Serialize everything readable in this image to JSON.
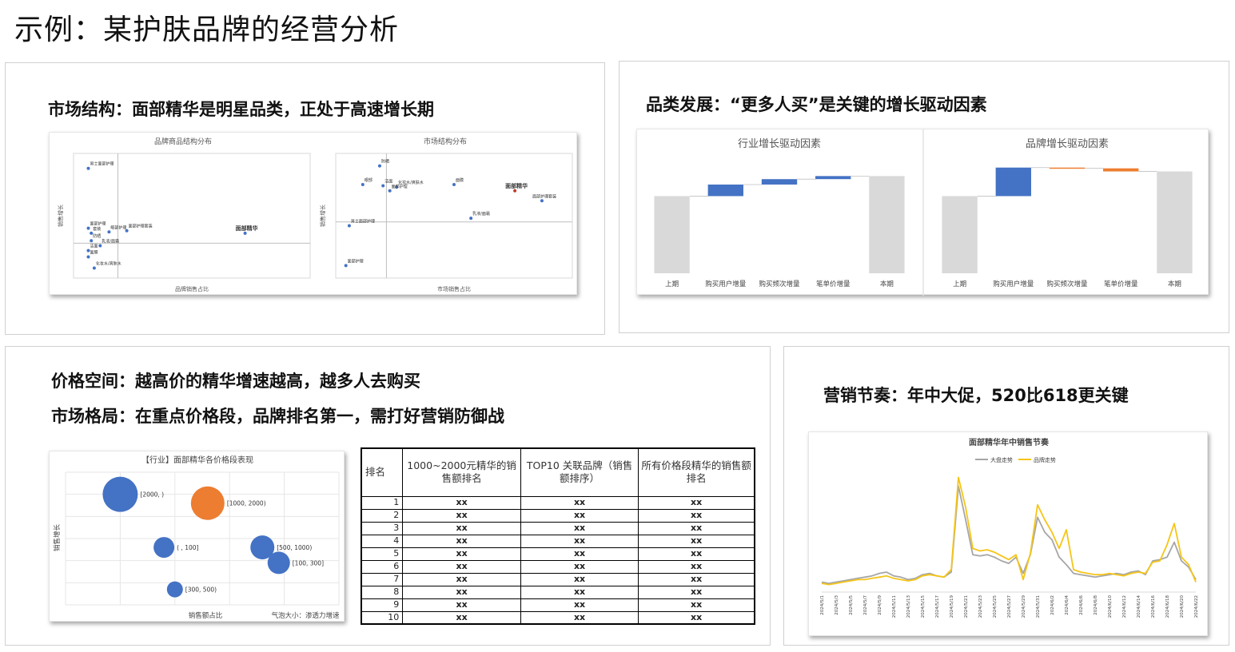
{
  "page": {
    "title": "示例：某护肤品牌的经营分析"
  },
  "panels": {
    "structure": {
      "heading": "市场结构：面部精华是明星品类，正处于高速增长期"
    },
    "category": {
      "heading": "品类发展：“更多人买”是关键的增长驱动因素"
    },
    "price": {
      "heading1": "价格空间：越高价的精华增速越高，越多人去购买",
      "heading2": "市场格局：在重点价格段，品牌排名第一，需打好营销防御战"
    },
    "marketing": {
      "heading": "营销节奏：年中大促，520比618更关键"
    }
  },
  "chart_data": [
    {
      "id": "brand-structure",
      "type": "scatter",
      "title": "品牌商品结构分布",
      "xlabel": "品牌销售占比",
      "ylabel": "销售增长",
      "points": [
        {
          "label": "男士面部护理",
          "x": 0.5,
          "y": 0.88
        },
        {
          "label": "面部护理",
          "x": 0.5,
          "y": 0.4
        },
        {
          "label": "套装",
          "x": 0.6,
          "y": 0.36
        },
        {
          "label": "眼部护理",
          "x": 1.2,
          "y": 0.37
        },
        {
          "label": "面部护理套装",
          "x": 1.8,
          "y": 0.38
        },
        {
          "label": "防晒",
          "x": 0.6,
          "y": 0.3
        },
        {
          "label": "乳液/面霜",
          "x": 0.9,
          "y": 0.26
        },
        {
          "label": "洁面",
          "x": 0.5,
          "y": 0.22
        },
        {
          "label": "面膜",
          "x": 0.5,
          "y": 0.17
        },
        {
          "label": "化妆水/爽肤水",
          "x": 0.7,
          "y": 0.08
        },
        {
          "label": "面部精华",
          "x": 5.8,
          "y": 0.36
        }
      ],
      "xlim": [
        0,
        8
      ],
      "ylim": [
        0,
        1
      ]
    },
    {
      "id": "market-structure",
      "type": "scatter",
      "title": "市场结构分布",
      "xlabel": "市场销售占比",
      "ylabel": "销售增长",
      "points": [
        {
          "label": "防晒",
          "x": 1.3,
          "y": 0.9
        },
        {
          "label": "眼部",
          "x": 0.8,
          "y": 0.75
        },
        {
          "label": "洁面",
          "x": 1.4,
          "y": 0.74
        },
        {
          "label": "化妆水/爽肤水",
          "x": 1.8,
          "y": 0.73
        },
        {
          "label": "面部护理",
          "x": 1.6,
          "y": 0.7
        },
        {
          "label": "面膜",
          "x": 3.5,
          "y": 0.75
        },
        {
          "label": "面部精华",
          "x": 5.3,
          "y": 0.7
        },
        {
          "label": "面部护理套装",
          "x": 6.1,
          "y": 0.62
        },
        {
          "label": "乳液/面霜",
          "x": 4.0,
          "y": 0.48
        },
        {
          "label": "男士面部护理",
          "x": 0.4,
          "y": 0.42
        },
        {
          "label": "面部护理",
          "x": 0.3,
          "y": 0.1
        }
      ],
      "xlim": [
        0,
        7
      ],
      "ylim": [
        0,
        1
      ]
    },
    {
      "id": "industry-drivers",
      "type": "bar",
      "title": "行业增长驱动因素",
      "categories": [
        "上期",
        "购买用户增量",
        "购买频次增量",
        "笔单价增量",
        "本期"
      ],
      "values": [
        100,
        15,
        7,
        4,
        126
      ],
      "colors": {
        "total": "#d9d9d9",
        "positive": "#4472c4",
        "negative": "#ed7d31"
      }
    },
    {
      "id": "brand-drivers",
      "type": "bar",
      "title": "品牌增长驱动因素",
      "categories": [
        "上期",
        "购买用户增量",
        "购买频次增量",
        "笔单价增量",
        "本期"
      ],
      "values": [
        100,
        37,
        -1,
        -4,
        132
      ],
      "colors": {
        "total": "#d9d9d9",
        "positive": "#4472c4",
        "negative": "#ed7d31"
      }
    },
    {
      "id": "price-bubbles",
      "type": "scatter",
      "title": "【行业】面部精华各价格段表现",
      "xlabel": "销售额占比",
      "ylabel": "销售增长",
      "note": "气泡大小：渗透力增速",
      "points": [
        {
          "label": "[2000, )",
          "x": 1.0,
          "y": 5.0,
          "size": 22,
          "color": "#4472c4"
        },
        {
          "label": "[1000, 2000)",
          "x": 2.6,
          "y": 4.6,
          "size": 21,
          "color": "#ed7d31"
        },
        {
          "label": "( , 100]",
          "x": 1.8,
          "y": 2.6,
          "size": 13,
          "color": "#4472c4"
        },
        {
          "label": "[500, 1000)",
          "x": 3.6,
          "y": 2.6,
          "size": 15,
          "color": "#4472c4"
        },
        {
          "label": "[100, 300]",
          "x": 3.9,
          "y": 1.9,
          "size": 14,
          "color": "#4472c4"
        },
        {
          "label": "[300, 500)",
          "x": 2.0,
          "y": 0.7,
          "size": 10,
          "color": "#4472c4"
        }
      ],
      "xlim": [
        0,
        5
      ],
      "ylim": [
        0,
        6
      ]
    },
    {
      "id": "ranking-table",
      "type": "table",
      "columns": [
        "排名",
        "1000~2000元精华的销售额排名",
        "TOP10 关联品牌（销售额排序）",
        "所有价格段精华的销售额排名"
      ],
      "rows": [
        [
          "1",
          "xx",
          "xx",
          "xx"
        ],
        [
          "2",
          "xx",
          "xx",
          "xx"
        ],
        [
          "3",
          "xx",
          "xx",
          "xx"
        ],
        [
          "4",
          "xx",
          "xx",
          "xx"
        ],
        [
          "5",
          "xx",
          "xx",
          "xx"
        ],
        [
          "6",
          "xx",
          "xx",
          "xx"
        ],
        [
          "7",
          "xx",
          "xx",
          "xx"
        ],
        [
          "8",
          "xx",
          "xx",
          "xx"
        ],
        [
          "9",
          "xx",
          "xx",
          "xx"
        ],
        [
          "10",
          "xx",
          "xx",
          "xx"
        ]
      ]
    },
    {
      "id": "sales-rhythm",
      "type": "line",
      "title": "面部精华年中销售节奏",
      "x": [
        "2024/5/1",
        "2024/5/2",
        "2024/5/3",
        "2024/5/4",
        "2024/5/5",
        "2024/5/6",
        "2024/5/7",
        "2024/5/8",
        "2024/5/9",
        "2024/5/10",
        "2024/5/11",
        "2024/5/12",
        "2024/5/13",
        "2024/5/14",
        "2024/5/15",
        "2024/5/16",
        "2024/5/17",
        "2024/5/18",
        "2024/5/19",
        "2024/5/20",
        "2024/5/21",
        "2024/5/22",
        "2024/5/23",
        "2024/5/24",
        "2024/5/25",
        "2024/5/26",
        "2024/5/27",
        "2024/5/28",
        "2024/5/29",
        "2024/5/30",
        "2024/5/31",
        "2024/6/1",
        "2024/6/2",
        "2024/6/3",
        "2024/6/4",
        "2024/6/5",
        "2024/6/6",
        "2024/6/7",
        "2024/6/8",
        "2024/6/9",
        "2024/6/10",
        "2024/6/11",
        "2024/6/12",
        "2024/6/13",
        "2024/6/14",
        "2024/6/15",
        "2024/6/16",
        "2024/6/17",
        "2024/6/18",
        "2024/6/19",
        "2024/6/20",
        "2024/6/21",
        "2024/6/22"
      ],
      "x_tick_labels": [
        "2024/5/1",
        "2024/5/3",
        "2024/5/5",
        "2024/5/7",
        "2024/5/9",
        "2024/5/11",
        "2024/5/13",
        "2024/5/15",
        "2024/5/17",
        "2024/5/19",
        "2024/5/21",
        "2024/5/23",
        "2024/5/25",
        "2024/5/27",
        "2024/5/29",
        "2024/5/31",
        "2024/6/2",
        "2024/6/4",
        "2024/6/6",
        "2024/6/8",
        "2024/6/10",
        "2024/6/12",
        "2024/6/14",
        "2024/6/16",
        "2024/6/18",
        "2024/6/20",
        "2024/6/22"
      ],
      "series": [
        {
          "name": "大盘走势",
          "color": "#a6a6a6",
          "values": [
            8,
            7,
            8,
            9,
            10,
            11,
            12,
            13,
            15,
            16,
            13,
            12,
            10,
            11,
            14,
            15,
            13,
            12,
            16,
            85,
            58,
            30,
            29,
            30,
            28,
            25,
            23,
            28,
            15,
            30,
            60,
            48,
            42,
            28,
            22,
            15,
            14,
            13,
            12,
            13,
            14,
            15,
            14,
            16,
            17,
            14,
            25,
            26,
            28,
            40,
            25,
            20,
            10
          ]
        },
        {
          "name": "品牌走势",
          "color": "#f5c518",
          "values": [
            7,
            6,
            7,
            8,
            9,
            10,
            10,
            11,
            12,
            13,
            11,
            10,
            9,
            10,
            13,
            14,
            13,
            12,
            18,
            92,
            68,
            35,
            33,
            34,
            32,
            29,
            26,
            30,
            10,
            31,
            70,
            58,
            48,
            35,
            50,
            18,
            16,
            15,
            14,
            14,
            15,
            14,
            13,
            15,
            16,
            15,
            24,
            25,
            38,
            55,
            28,
            22,
            8
          ]
        }
      ],
      "legend": "top"
    }
  ]
}
